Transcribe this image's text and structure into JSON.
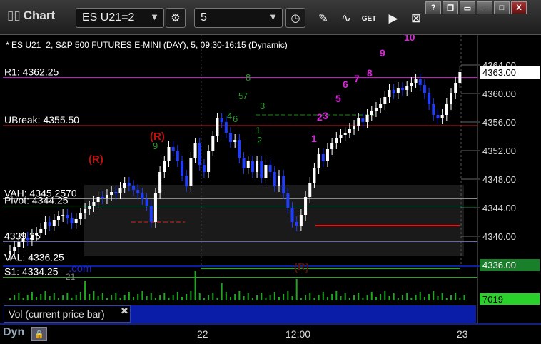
{
  "window": {
    "title": "Chart",
    "close_symbol": "X"
  },
  "toolbar": {
    "symbol": "ES U21=2",
    "interval": "5"
  },
  "chart": {
    "header": "* ES U21=2, S&P 500 FUTURES E-MINI (DAY), 5, 09:30-16:15 (Dynamic)",
    "levels": [
      {
        "label": "R1: 4362.25",
        "value": 4362.25,
        "color": "#c21dc2"
      },
      {
        "label": "UBreak: 4355.50",
        "value": 4355.5,
        "color": "#b22"
      },
      {
        "label": "VAH: 4345.2570",
        "value": 4345.257,
        "color": "#999"
      },
      {
        "label": "Pivot: 4344.25",
        "value": 4344.25,
        "color": "#2a7"
      },
      {
        "label": "4339.25",
        "value": 4339.25,
        "color": "#66a"
      },
      {
        "label": "VAL: 4336.25",
        "value": 4336.25,
        "color": "#777"
      },
      {
        "label": "S1: 4334.25",
        "value": 4334.25,
        "color": "#2a2"
      }
    ],
    "y_ticks": [
      "4364.00",
      "4360.00",
      "4356.00",
      "4352.00",
      "4348.00",
      "4344.00",
      "4340.00"
    ],
    "price_badge": "4363.00",
    "bottom_badge": "4336.00",
    "vol_badge": "7019",
    "x_labels": [
      "22",
      "12:00",
      "23"
    ],
    "annotations": [
      "(R)",
      "(R)",
      "(R)"
    ],
    "magenta_counts": [
      "1",
      "2",
      "3",
      "5",
      "6",
      "7",
      "8",
      "9",
      "10"
    ],
    "green_counts": [
      "1",
      "2",
      "3",
      "4",
      "5",
      "6",
      "7",
      "8",
      "9"
    ],
    "watermark": ".com",
    "extra": "21"
  },
  "volume_panel": {
    "label": "Vol (current price bar)"
  },
  "status": {
    "mode": "Dyn"
  }
}
